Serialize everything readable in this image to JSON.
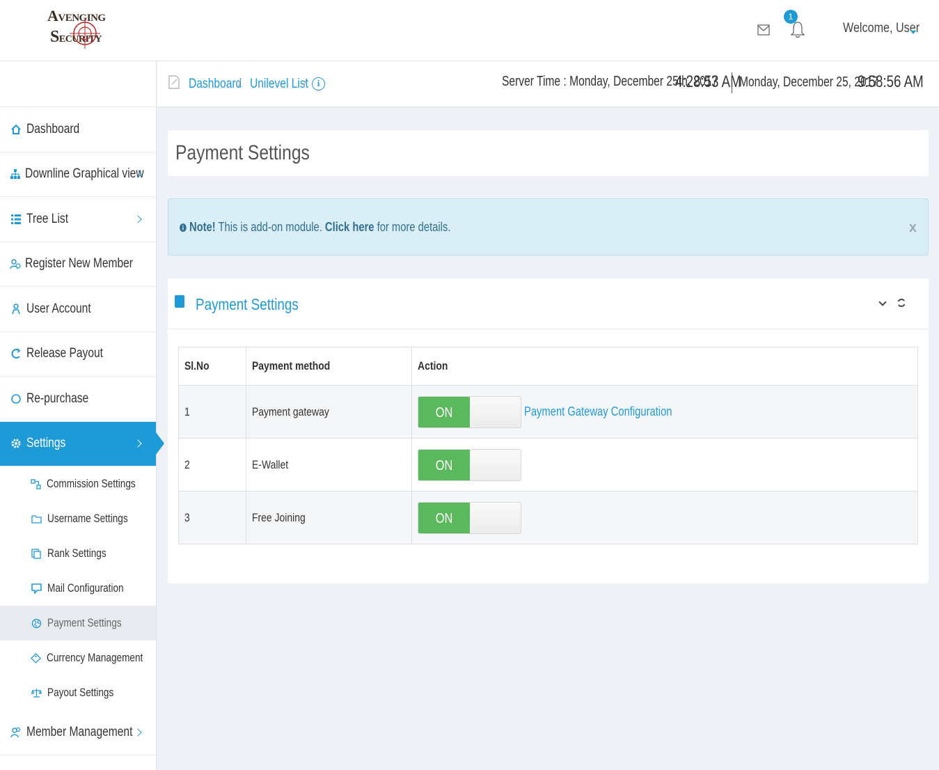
{
  "header": {
    "logo_line1": "VENGING",
    "logo_line1_prefix": "A",
    "logo_line2": "ECURITY",
    "logo_line2_prefix": "S",
    "notification_count": "1",
    "welcome": "Welcome, User"
  },
  "breadcrumb": {
    "items": [
      "Dashboard",
      "Unilevel List"
    ],
    "separator": "/",
    "info_glyph": "i"
  },
  "clock": {
    "server_label": "Server Time : Monday, December 25th, 2017",
    "server_time": "4:28:53 AM",
    "local_date": "Monday, December 25, 2017",
    "local_time": "9:58:56 AM"
  },
  "sidebar": {
    "items": [
      {
        "label": "Dashboard",
        "icon": "home-icon"
      },
      {
        "label": "Downline Graphical view",
        "icon": "sitemap-icon"
      },
      {
        "label": "Tree List",
        "icon": "list-icon"
      },
      {
        "label": "Register New Member",
        "icon": "user-add-icon"
      },
      {
        "label": "User Account",
        "icon": "user-icon"
      },
      {
        "label": "Release Payout",
        "icon": "refresh-icon"
      },
      {
        "label": "Re-purchase",
        "icon": "circle-icon"
      },
      {
        "label": "Settings",
        "icon": "gear-icon"
      }
    ],
    "sub_items": [
      {
        "label": "Commission Settings",
        "icon": "share-icon"
      },
      {
        "label": "Username Settings",
        "icon": "folder-icon"
      },
      {
        "label": "Rank Settings",
        "icon": "copy-icon"
      },
      {
        "label": "Mail Configuration",
        "icon": "mail-icon"
      },
      {
        "label": "Payment Settings",
        "icon": "globe-icon"
      },
      {
        "label": "Currency Management",
        "icon": "tag-icon"
      },
      {
        "label": "Payout Settings",
        "icon": "scale-icon"
      }
    ],
    "after_items": [
      {
        "label": "Member Management",
        "icon": "users-icon"
      }
    ]
  },
  "page": {
    "title": "Payment Settings"
  },
  "note": {
    "strong": "Note!",
    "text": " This is add-on module. ",
    "link": "Click here",
    "suffix": " for more details.",
    "close": "x"
  },
  "panel": {
    "title": "Payment Settings"
  },
  "table": {
    "headers": [
      "Sl.No",
      "Payment method",
      "Action"
    ],
    "rows": [
      {
        "no": "1",
        "method": "Payment gateway",
        "toggle": "ON",
        "link": "Payment Gateway Configuration"
      },
      {
        "no": "2",
        "method": "E-Wallet",
        "toggle": "ON",
        "link": ""
      },
      {
        "no": "3",
        "method": "Free Joining",
        "toggle": "ON",
        "link": ""
      }
    ]
  },
  "colors": {
    "accent": "#1e9bd7",
    "toggle_on": "#5cb85c",
    "note_bg": "#d9eef7"
  }
}
